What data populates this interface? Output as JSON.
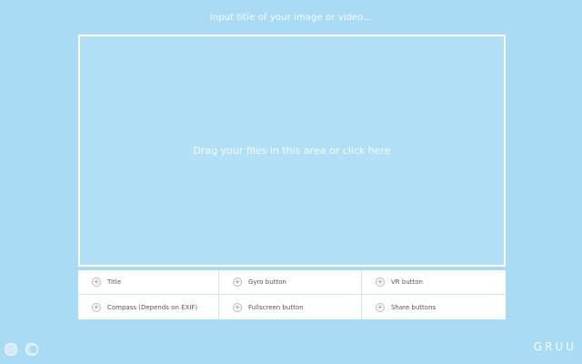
{
  "header": {
    "title_placeholder": "Input title of your image or video..."
  },
  "drop_zone": {
    "text": "Drag your files in this area or click here"
  },
  "options": [
    {
      "label": "Title"
    },
    {
      "label": "Gyro button"
    },
    {
      "label": "VR button"
    },
    {
      "label": "Compass (Depends on EXIF)"
    },
    {
      "label": "Fullscreen button"
    },
    {
      "label": "Share buttons"
    }
  ],
  "footer": {
    "logo": "GRUU"
  },
  "colors": {
    "background": "#a9dcf4",
    "drop_zone_border": "#ffffff",
    "option_background": "#ffffff",
    "option_text": "#555555"
  },
  "icons": {
    "option_add": "plus-circle-icon"
  }
}
